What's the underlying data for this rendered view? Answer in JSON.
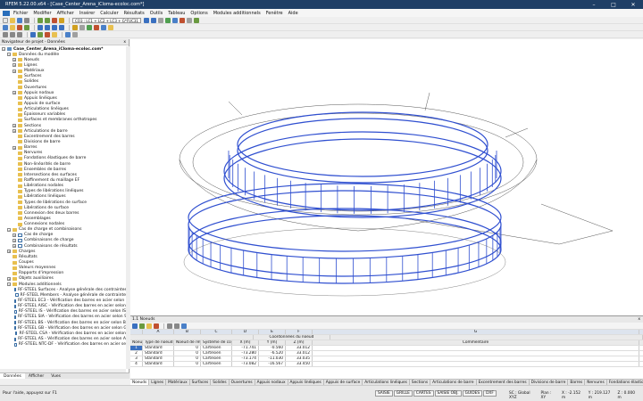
{
  "titlebar": {
    "title": "RFEM 5.22.00.x64 - [Case_Center_Arena_iCloma-ecoloc.com*]",
    "min": "–",
    "max": "□",
    "close": "✕"
  },
  "menu": [
    "Fichier",
    "Modifier",
    "Afficher",
    "Insérer",
    "Calculer",
    "Résultats",
    "Outils",
    "Tableau",
    "Options",
    "Modules additionnels",
    "Fenêtre",
    "Aide"
  ],
  "toolbar": {
    "loadcase_combo": "CO3 : LC1 + LC2 + LC3 + G*FUC31"
  },
  "navigator": {
    "title": "Navigateur de projet - Données",
    "close": "x",
    "items": [
      {
        "label": "Case_Center_Arena_iCloma-ecoloc.com*",
        "level": 0,
        "icon": "root",
        "exp": "−",
        "bold": true
      },
      {
        "label": "Données du modèle",
        "level": 1,
        "icon": "folder",
        "exp": "−"
      },
      {
        "label": "Noeuds",
        "level": 2,
        "icon": "folder",
        "exp": "+"
      },
      {
        "label": "Lignes",
        "level": 2,
        "icon": "folder",
        "exp": "+"
      },
      {
        "label": "Matériaux",
        "level": 2,
        "icon": "folder",
        "exp": "+"
      },
      {
        "label": "Surfaces",
        "level": 2,
        "icon": "folder",
        "exp": ""
      },
      {
        "label": "Solides",
        "level": 2,
        "icon": "folder",
        "exp": ""
      },
      {
        "label": "Ouvertures",
        "level": 2,
        "icon": "folder",
        "exp": ""
      },
      {
        "label": "Appuis nodaux",
        "level": 2,
        "icon": "folder",
        "exp": "+"
      },
      {
        "label": "Appuis linéiques",
        "level": 2,
        "icon": "folder",
        "exp": ""
      },
      {
        "label": "Appuis de surface",
        "level": 2,
        "icon": "folder",
        "exp": ""
      },
      {
        "label": "Articulations linéiques",
        "level": 2,
        "icon": "folder",
        "exp": ""
      },
      {
        "label": "Épaisseurs variables",
        "level": 2,
        "icon": "folder",
        "exp": ""
      },
      {
        "label": "Surfaces et membranes orthotropes",
        "level": 2,
        "icon": "folder",
        "exp": ""
      },
      {
        "label": "Sections",
        "level": 2,
        "icon": "folder",
        "exp": "+"
      },
      {
        "label": "Articulations de barre",
        "level": 2,
        "icon": "folder",
        "exp": "+"
      },
      {
        "label": "Excentrement des barres",
        "level": 2,
        "icon": "folder",
        "exp": ""
      },
      {
        "label": "Divisions de barre",
        "level": 2,
        "icon": "folder",
        "exp": ""
      },
      {
        "label": "Barres",
        "level": 2,
        "icon": "folder",
        "exp": "+"
      },
      {
        "label": "Nervures",
        "level": 2,
        "icon": "folder",
        "exp": ""
      },
      {
        "label": "Fondations élastiques de barre",
        "level": 2,
        "icon": "folder",
        "exp": ""
      },
      {
        "label": "Non-linéarités de barre",
        "level": 2,
        "icon": "folder",
        "exp": ""
      },
      {
        "label": "Ensembles de barres",
        "level": 2,
        "icon": "folder",
        "exp": ""
      },
      {
        "label": "Intersections des surfaces",
        "level": 2,
        "icon": "folder",
        "exp": ""
      },
      {
        "label": "Raffinement du maillage EF",
        "level": 2,
        "icon": "folder",
        "exp": ""
      },
      {
        "label": "Libérations nodales",
        "level": 2,
        "icon": "folder",
        "exp": ""
      },
      {
        "label": "Types de libérations linéiques",
        "level": 2,
        "icon": "folder",
        "exp": ""
      },
      {
        "label": "Libérations linéiques",
        "level": 2,
        "icon": "folder",
        "exp": ""
      },
      {
        "label": "Types de libérations de surface",
        "level": 2,
        "icon": "folder",
        "exp": ""
      },
      {
        "label": "Libérations de surface",
        "level": 2,
        "icon": "folder",
        "exp": ""
      },
      {
        "label": "Connexion des deux barres",
        "level": 2,
        "icon": "folder",
        "exp": ""
      },
      {
        "label": "Assemblages",
        "level": 2,
        "icon": "folder",
        "exp": ""
      },
      {
        "label": "Connexions nodales",
        "level": 2,
        "icon": "folder",
        "exp": ""
      },
      {
        "label": "Cas de charge et combinaisons",
        "level": 1,
        "icon": "folder",
        "exp": "−"
      },
      {
        "label": "Cas de charge",
        "level": 2,
        "icon": "doc",
        "exp": "+"
      },
      {
        "label": "Combinaisons de charge",
        "level": 2,
        "icon": "doc",
        "exp": "+"
      },
      {
        "label": "Combinaisons de résultats",
        "level": 2,
        "icon": "doc",
        "exp": "+"
      },
      {
        "label": "Charges",
        "level": 1,
        "icon": "folder",
        "exp": "+"
      },
      {
        "label": "Résultats",
        "level": 1,
        "icon": "folder",
        "exp": ""
      },
      {
        "label": "Coupes",
        "level": 1,
        "icon": "folder",
        "exp": ""
      },
      {
        "label": "Valeurs moyennes",
        "level": 1,
        "icon": "folder",
        "exp": ""
      },
      {
        "label": "Rapports d'impression",
        "level": 1,
        "icon": "folder",
        "exp": ""
      },
      {
        "label": "Objets auxiliaires",
        "level": 1,
        "icon": "folder",
        "exp": "+"
      },
      {
        "label": "Modules additionnels",
        "level": 1,
        "icon": "folder",
        "exp": "−"
      },
      {
        "label": "RF-STEEL Surfaces - Analyse générale des contraintes",
        "level": 2,
        "icon": "doc",
        "exp": ""
      },
      {
        "label": "RF-STEEL Members - Analyse générale de contrainte",
        "level": 2,
        "icon": "doc",
        "exp": ""
      },
      {
        "label": "RF-STEEL EC3 - Vérification des barres en acier selon l",
        "level": 2,
        "icon": "doc",
        "exp": ""
      },
      {
        "label": "RF-STEEL AISC - Vérification des barres en acier selon A",
        "level": 2,
        "icon": "doc",
        "exp": ""
      },
      {
        "label": "RF-STEEL IS - Vérification des barres en acier selon IS",
        "level": 2,
        "icon": "doc",
        "exp": ""
      },
      {
        "label": "RF-STEEL SIA - Vérification des barres en acier selon S",
        "level": 2,
        "icon": "doc",
        "exp": ""
      },
      {
        "label": "RF-STEEL BS - Vérification des barres en acier selon BS",
        "level": 2,
        "icon": "doc",
        "exp": ""
      },
      {
        "label": "RF-STEEL GB - Vérification des barres en acier selon G",
        "level": 2,
        "icon": "doc",
        "exp": ""
      },
      {
        "label": "RF-STEEL CSA - Vérification des barres en acier selon",
        "level": 2,
        "icon": "doc",
        "exp": ""
      },
      {
        "label": "RF-STEEL AS - Vérification des barres en acier selon A",
        "level": 2,
        "icon": "doc",
        "exp": ""
      },
      {
        "label": "RF-STEEL NTC-DF - Vérification des barres en acier se",
        "level": 2,
        "icon": "doc",
        "exp": ""
      }
    ],
    "tabs": [
      "Données",
      "Afficher",
      "Vues"
    ]
  },
  "table": {
    "title": "1.1 Noeuds",
    "close": "x",
    "letters": [
      "",
      "A",
      "B",
      "C",
      "D",
      "E",
      "F",
      "G"
    ],
    "header": [
      "Noeud n°",
      "Type de noeud",
      "Noeud de référence",
      "Système de coordonnées",
      "X [m]",
      "Y [m]",
      "Z [m]",
      "Commentaire"
    ],
    "group_header": "Coordonnées du noeud",
    "rows": [
      [
        "1",
        "Standard",
        "0",
        "Cartésien",
        "-71.741",
        "-0.560",
        "33.012",
        ""
      ],
      [
        "2",
        "Standard",
        "0",
        "Cartésien",
        "-73.280",
        "-6.520",
        "33.012",
        ""
      ],
      [
        "3",
        "Standard",
        "0",
        "Cartésien",
        "-73.174",
        "-11.030",
        "33.035",
        ""
      ],
      [
        "4",
        "Standard",
        "0",
        "Cartésien",
        "-73.082",
        "-16.567",
        "33.450",
        ""
      ]
    ]
  },
  "sheet_tabs": [
    "Noeuds",
    "Lignes",
    "Matériaux",
    "Surfaces",
    "Solides",
    "Ouvertures",
    "Appuis nodaux",
    "Appuis linéiques",
    "Appuis de surface",
    "Articulations linéiques",
    "Sections",
    "Articulations de barre",
    "Excentrement des barres",
    "Divisions de barre",
    "Barres",
    "Nervures",
    "Fondations élastiques de barre"
  ],
  "status": {
    "left": "Pour l'aide, appuyez sur F1",
    "modes": [
      "SAISIE",
      "GRILLE",
      "CARTES",
      "SAISIE OBJ.",
      "GUIDES",
      "DXF"
    ],
    "cs": "SC : Global XYZ",
    "plane": "Plan : XY",
    "x": "X : -2.152 m",
    "y": "Y : 219.127 m",
    "z": "Z : 0.000 m"
  }
}
